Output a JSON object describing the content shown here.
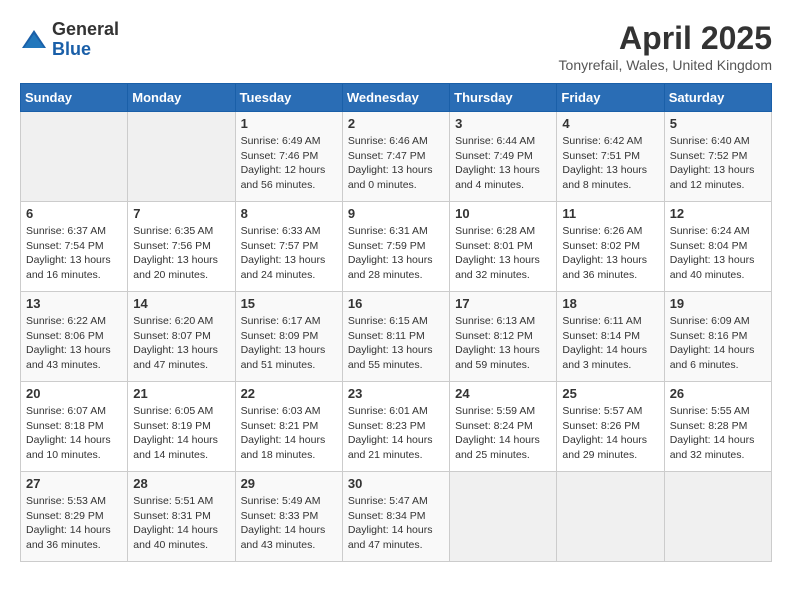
{
  "logo": {
    "general": "General",
    "blue": "Blue"
  },
  "title": {
    "month": "April 2025",
    "location": "Tonyrefail, Wales, United Kingdom"
  },
  "headers": [
    "Sunday",
    "Monday",
    "Tuesday",
    "Wednesday",
    "Thursday",
    "Friday",
    "Saturday"
  ],
  "weeks": [
    [
      {
        "day": "",
        "info": ""
      },
      {
        "day": "",
        "info": ""
      },
      {
        "day": "1",
        "info": "Sunrise: 6:49 AM\nSunset: 7:46 PM\nDaylight: 12 hours\nand 56 minutes."
      },
      {
        "day": "2",
        "info": "Sunrise: 6:46 AM\nSunset: 7:47 PM\nDaylight: 13 hours\nand 0 minutes."
      },
      {
        "day": "3",
        "info": "Sunrise: 6:44 AM\nSunset: 7:49 PM\nDaylight: 13 hours\nand 4 minutes."
      },
      {
        "day": "4",
        "info": "Sunrise: 6:42 AM\nSunset: 7:51 PM\nDaylight: 13 hours\nand 8 minutes."
      },
      {
        "day": "5",
        "info": "Sunrise: 6:40 AM\nSunset: 7:52 PM\nDaylight: 13 hours\nand 12 minutes."
      }
    ],
    [
      {
        "day": "6",
        "info": "Sunrise: 6:37 AM\nSunset: 7:54 PM\nDaylight: 13 hours\nand 16 minutes."
      },
      {
        "day": "7",
        "info": "Sunrise: 6:35 AM\nSunset: 7:56 PM\nDaylight: 13 hours\nand 20 minutes."
      },
      {
        "day": "8",
        "info": "Sunrise: 6:33 AM\nSunset: 7:57 PM\nDaylight: 13 hours\nand 24 minutes."
      },
      {
        "day": "9",
        "info": "Sunrise: 6:31 AM\nSunset: 7:59 PM\nDaylight: 13 hours\nand 28 minutes."
      },
      {
        "day": "10",
        "info": "Sunrise: 6:28 AM\nSunset: 8:01 PM\nDaylight: 13 hours\nand 32 minutes."
      },
      {
        "day": "11",
        "info": "Sunrise: 6:26 AM\nSunset: 8:02 PM\nDaylight: 13 hours\nand 36 minutes."
      },
      {
        "day": "12",
        "info": "Sunrise: 6:24 AM\nSunset: 8:04 PM\nDaylight: 13 hours\nand 40 minutes."
      }
    ],
    [
      {
        "day": "13",
        "info": "Sunrise: 6:22 AM\nSunset: 8:06 PM\nDaylight: 13 hours\nand 43 minutes."
      },
      {
        "day": "14",
        "info": "Sunrise: 6:20 AM\nSunset: 8:07 PM\nDaylight: 13 hours\nand 47 minutes."
      },
      {
        "day": "15",
        "info": "Sunrise: 6:17 AM\nSunset: 8:09 PM\nDaylight: 13 hours\nand 51 minutes."
      },
      {
        "day": "16",
        "info": "Sunrise: 6:15 AM\nSunset: 8:11 PM\nDaylight: 13 hours\nand 55 minutes."
      },
      {
        "day": "17",
        "info": "Sunrise: 6:13 AM\nSunset: 8:12 PM\nDaylight: 13 hours\nand 59 minutes."
      },
      {
        "day": "18",
        "info": "Sunrise: 6:11 AM\nSunset: 8:14 PM\nDaylight: 14 hours\nand 3 minutes."
      },
      {
        "day": "19",
        "info": "Sunrise: 6:09 AM\nSunset: 8:16 PM\nDaylight: 14 hours\nand 6 minutes."
      }
    ],
    [
      {
        "day": "20",
        "info": "Sunrise: 6:07 AM\nSunset: 8:18 PM\nDaylight: 14 hours\nand 10 minutes."
      },
      {
        "day": "21",
        "info": "Sunrise: 6:05 AM\nSunset: 8:19 PM\nDaylight: 14 hours\nand 14 minutes."
      },
      {
        "day": "22",
        "info": "Sunrise: 6:03 AM\nSunset: 8:21 PM\nDaylight: 14 hours\nand 18 minutes."
      },
      {
        "day": "23",
        "info": "Sunrise: 6:01 AM\nSunset: 8:23 PM\nDaylight: 14 hours\nand 21 minutes."
      },
      {
        "day": "24",
        "info": "Sunrise: 5:59 AM\nSunset: 8:24 PM\nDaylight: 14 hours\nand 25 minutes."
      },
      {
        "day": "25",
        "info": "Sunrise: 5:57 AM\nSunset: 8:26 PM\nDaylight: 14 hours\nand 29 minutes."
      },
      {
        "day": "26",
        "info": "Sunrise: 5:55 AM\nSunset: 8:28 PM\nDaylight: 14 hours\nand 32 minutes."
      }
    ],
    [
      {
        "day": "27",
        "info": "Sunrise: 5:53 AM\nSunset: 8:29 PM\nDaylight: 14 hours\nand 36 minutes."
      },
      {
        "day": "28",
        "info": "Sunrise: 5:51 AM\nSunset: 8:31 PM\nDaylight: 14 hours\nand 40 minutes."
      },
      {
        "day": "29",
        "info": "Sunrise: 5:49 AM\nSunset: 8:33 PM\nDaylight: 14 hours\nand 43 minutes."
      },
      {
        "day": "30",
        "info": "Sunrise: 5:47 AM\nSunset: 8:34 PM\nDaylight: 14 hours\nand 47 minutes."
      },
      {
        "day": "",
        "info": ""
      },
      {
        "day": "",
        "info": ""
      },
      {
        "day": "",
        "info": ""
      }
    ]
  ]
}
